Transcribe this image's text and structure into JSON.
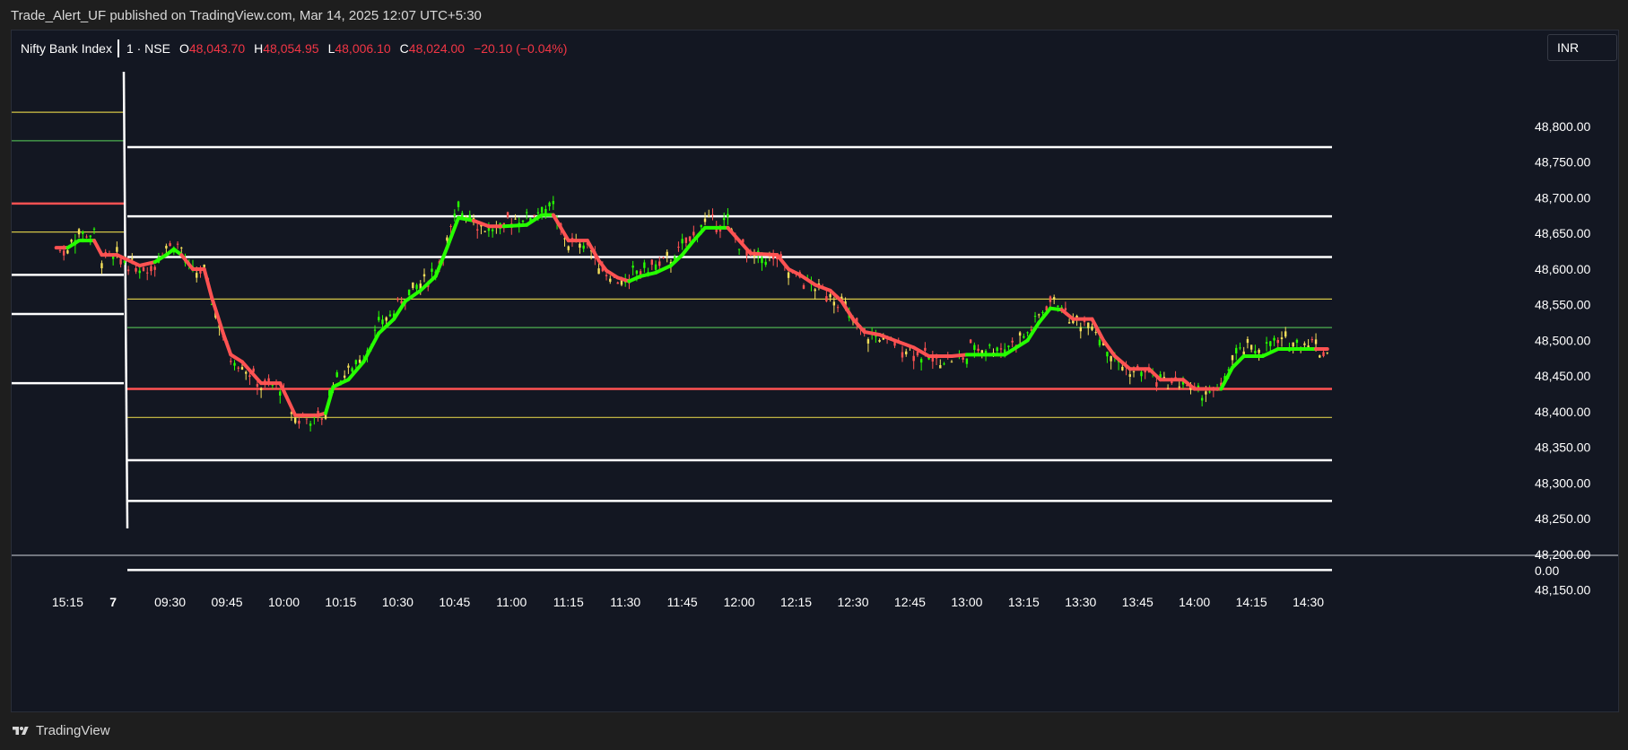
{
  "caption": "Trade_Alert_UF published on TradingView.com, Mar 14, 2025 12:07 UTC+5:30",
  "legend": {
    "symbol": "Nifty Bank Index",
    "meta": "1 · NSE",
    "o_key": "O",
    "o_val": "48,043.70",
    "h_key": "H",
    "h_val": "48,054.95",
    "l_key": "L",
    "l_val": "48,006.10",
    "c_key": "C",
    "c_val": "48,024.00",
    "change": "−20.10 (−0.04%)"
  },
  "currency": "INR",
  "brand": "TradingView",
  "colors": {
    "background": "#131722",
    "up": "#26ff00",
    "down": "#ff5252",
    "neutral_candle": "#f5e05a",
    "level_white": "#ffffff",
    "level_red": "#ff5252",
    "level_green": "#4caf50",
    "level_yellow": "#d4c646"
  },
  "chart_data": {
    "type": "line",
    "symbol": "Nifty Bank Index",
    "y_range": [
      48130,
      48890
    ],
    "y_ticks": [
      48800,
      48750,
      48700,
      48650,
      48600,
      48550,
      48500,
      48450,
      48400,
      48350,
      48300,
      48250,
      48200,
      48150
    ],
    "y_tick_labels": [
      "48,800.00",
      "48,750.00",
      "48,700.00",
      "48,650.00",
      "48,600.00",
      "48,550.00",
      "48,500.00",
      "48,450.00",
      "48,400.00",
      "48,350.00",
      "48,300.00",
      "48,250.00",
      "48,200.00",
      "48,150.00"
    ],
    "sub_axis_label": "0.00",
    "x_ticks": [
      "15:15",
      "7",
      "09:30",
      "09:45",
      "10:00",
      "10:15",
      "10:30",
      "10:45",
      "11:00",
      "11:15",
      "11:30",
      "11:45",
      "12:00",
      "12:15",
      "12:30",
      "12:45",
      "13:00",
      "13:15",
      "13:30",
      "13:45",
      "14:00",
      "14:15",
      "14:30"
    ],
    "x_range_minutes": [
      -10,
      326
    ],
    "x_tick_minutes": [
      -7,
      5,
      20,
      35,
      50,
      65,
      80,
      95,
      110,
      125,
      140,
      155,
      170,
      185,
      200,
      215,
      230,
      245,
      260,
      275,
      290,
      305,
      320
    ],
    "levels_current": [
      {
        "price": 48771,
        "color": "white"
      },
      {
        "price": 48674,
        "color": "white"
      },
      {
        "price": 48617,
        "color": "white"
      },
      {
        "price": 48558,
        "color": "yellow"
      },
      {
        "price": 48518,
        "color": "green"
      },
      {
        "price": 48432,
        "color": "red"
      },
      {
        "price": 48392,
        "color": "yellow"
      },
      {
        "price": 48332,
        "color": "white"
      },
      {
        "price": 48275,
        "color": "white"
      },
      {
        "price": 48178,
        "color": "white"
      }
    ],
    "levels_previous": [
      {
        "price": 48820,
        "color": "yellow"
      },
      {
        "price": 48780,
        "color": "green"
      },
      {
        "price": 48692,
        "color": "red"
      },
      {
        "price": 48652,
        "color": "yellow"
      },
      {
        "price": 48592,
        "color": "white"
      },
      {
        "price": 48537,
        "color": "white"
      },
      {
        "price": 48440,
        "color": "white"
      }
    ],
    "session_break_minute": 2,
    "trend_line": {
      "name": "",
      "points": [
        [
          -10,
          48630,
          "down"
        ],
        [
          -7,
          48630,
          "up"
        ],
        [
          -4,
          48640,
          "up"
        ],
        [
          0,
          48640,
          "down"
        ],
        [
          2,
          48620,
          "down"
        ],
        [
          6,
          48620,
          "down"
        ],
        [
          12,
          48605,
          "down"
        ],
        [
          16,
          48610,
          "up"
        ],
        [
          19,
          48620,
          "up"
        ],
        [
          21,
          48628,
          "up"
        ],
        [
          23,
          48620,
          "down"
        ],
        [
          26,
          48600,
          "down"
        ],
        [
          29,
          48600,
          "down"
        ],
        [
          31,
          48560,
          "down"
        ],
        [
          34,
          48510,
          "down"
        ],
        [
          36,
          48480,
          "down"
        ],
        [
          39,
          48470,
          "down"
        ],
        [
          44,
          48440,
          "down"
        ],
        [
          49,
          48440,
          "down"
        ],
        [
          53,
          48395,
          "down"
        ],
        [
          59,
          48395,
          "down"
        ],
        [
          61,
          48398,
          "up"
        ],
        [
          63,
          48435,
          "up"
        ],
        [
          67,
          48445,
          "up"
        ],
        [
          71,
          48470,
          "up"
        ],
        [
          75,
          48510,
          "up"
        ],
        [
          79,
          48530,
          "up"
        ],
        [
          82,
          48555,
          "up"
        ],
        [
          86,
          48570,
          "up"
        ],
        [
          90,
          48590,
          "up"
        ],
        [
          93,
          48630,
          "up"
        ],
        [
          96,
          48672,
          "up"
        ],
        [
          100,
          48668,
          "down"
        ],
        [
          104,
          48660,
          "down"
        ],
        [
          108,
          48660,
          "up"
        ],
        [
          114,
          48662,
          "up"
        ],
        [
          118,
          48676,
          "up"
        ],
        [
          121,
          48676,
          "down"
        ],
        [
          125,
          48640,
          "down"
        ],
        [
          130,
          48640,
          "down"
        ],
        [
          133,
          48612,
          "down"
        ],
        [
          135,
          48598,
          "down"
        ],
        [
          138,
          48588,
          "down"
        ],
        [
          141,
          48583,
          "up"
        ],
        [
          144,
          48590,
          "up"
        ],
        [
          148,
          48595,
          "up"
        ],
        [
          152,
          48605,
          "up"
        ],
        [
          155,
          48620,
          "up"
        ],
        [
          158,
          48640,
          "up"
        ],
        [
          161,
          48658,
          "up"
        ],
        [
          167,
          48658,
          "down"
        ],
        [
          170,
          48640,
          "down"
        ],
        [
          173,
          48622,
          "down"
        ],
        [
          180,
          48620,
          "down"
        ],
        [
          183,
          48600,
          "down"
        ],
        [
          186,
          48592,
          "down"
        ],
        [
          190,
          48578,
          "down"
        ],
        [
          194,
          48570,
          "down"
        ],
        [
          197,
          48555,
          "down"
        ],
        [
          200,
          48530,
          "down"
        ],
        [
          203,
          48512,
          "down"
        ],
        [
          207,
          48508,
          "down"
        ],
        [
          212,
          48498,
          "down"
        ],
        [
          216,
          48490,
          "down"
        ],
        [
          220,
          48478,
          "down"
        ],
        [
          226,
          48478,
          "down"
        ],
        [
          230,
          48480,
          "up"
        ],
        [
          236,
          48480,
          "up"
        ],
        [
          240,
          48480,
          "up"
        ],
        [
          243,
          48490,
          "up"
        ],
        [
          246,
          48500,
          "up"
        ],
        [
          249,
          48525,
          "up"
        ],
        [
          252,
          48545,
          "up"
        ],
        [
          255,
          48543,
          "down"
        ],
        [
          258,
          48530,
          "down"
        ],
        [
          263,
          48530,
          "down"
        ],
        [
          266,
          48500,
          "down"
        ],
        [
          269,
          48478,
          "down"
        ],
        [
          273,
          48460,
          "down"
        ],
        [
          278,
          48460,
          "down"
        ],
        [
          281,
          48445,
          "down"
        ],
        [
          287,
          48445,
          "down"
        ],
        [
          290,
          48432,
          "down"
        ],
        [
          294,
          48432,
          "down"
        ],
        [
          297,
          48432,
          "up"
        ],
        [
          300,
          48462,
          "up"
        ],
        [
          303,
          48478,
          "up"
        ],
        [
          308,
          48478,
          "up"
        ],
        [
          312,
          48488,
          "up"
        ],
        [
          318,
          48488,
          "up"
        ],
        [
          322,
          48488,
          "down"
        ],
        [
          325,
          48488,
          "down"
        ]
      ]
    }
  }
}
